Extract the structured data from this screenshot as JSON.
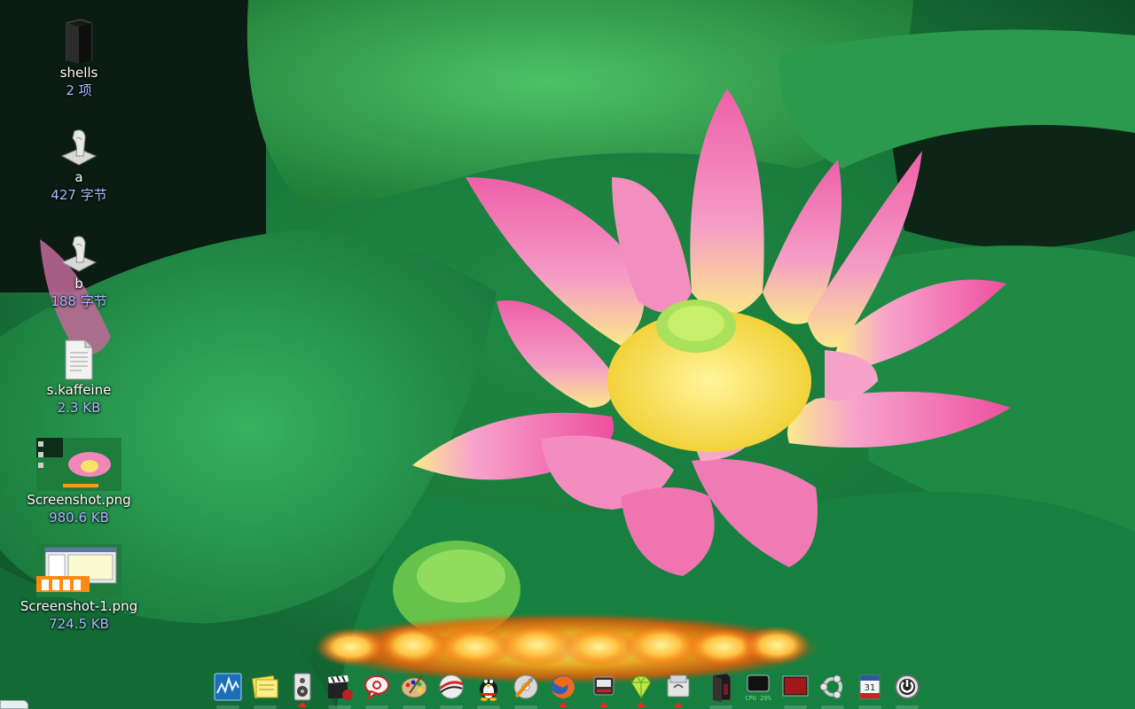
{
  "desktop": {
    "items": [
      {
        "name": "shells",
        "size": "2 项",
        "icon": "folder-icon"
      },
      {
        "name": "a",
        "size": "427 字节",
        "icon": "script-icon"
      },
      {
        "name": "b",
        "size": "188 字节",
        "icon": "script-icon"
      },
      {
        "name": "s.kaffeine",
        "size": "2.3 KB",
        "icon": "text-file-icon"
      },
      {
        "name": "Screenshot.png",
        "size": "980.6 KB",
        "icon": "image-thumbnail-lotus"
      },
      {
        "name": "Screenshot-1.png",
        "size": "724.5 KB",
        "icon": "image-thumbnail-desktop"
      }
    ]
  },
  "dock": {
    "items": [
      {
        "icon": "system-monitor-icon",
        "running": false
      },
      {
        "icon": "sticky-notes-icon",
        "running": false
      },
      {
        "icon": "speaker-icon",
        "running": true
      },
      {
        "icon": "movie-clapper-icon",
        "running": false
      },
      {
        "icon": "chat-bubble-icon",
        "running": false
      },
      {
        "icon": "paint-palette-icon",
        "running": false
      },
      {
        "icon": "globe-swoosh-icon",
        "running": false
      },
      {
        "icon": "qq-penguin-icon",
        "running": false
      },
      {
        "icon": "disk-tool-icon",
        "running": false
      },
      {
        "icon": "firefox-icon",
        "running": true
      },
      {
        "icon": "media-player-icon",
        "running": true
      },
      {
        "icon": "diamond-gem-icon",
        "running": true
      },
      {
        "icon": "calculator-icon",
        "running": true
      },
      {
        "icon": "dark-file-icon",
        "running": false
      },
      {
        "icon": "cpu-monitor-icon",
        "running": false,
        "label": "CPU 29%"
      },
      {
        "icon": "terminal-icon",
        "running": false
      },
      {
        "icon": "ubuntu-logo-icon",
        "running": false
      },
      {
        "icon": "calendar-icon",
        "running": false,
        "label": "31"
      },
      {
        "icon": "power-icon",
        "running": false
      }
    ]
  },
  "colors": {
    "label_text": "#ffffff",
    "size_text": "#a9b8ff",
    "running_indicator": "#ff2020"
  }
}
